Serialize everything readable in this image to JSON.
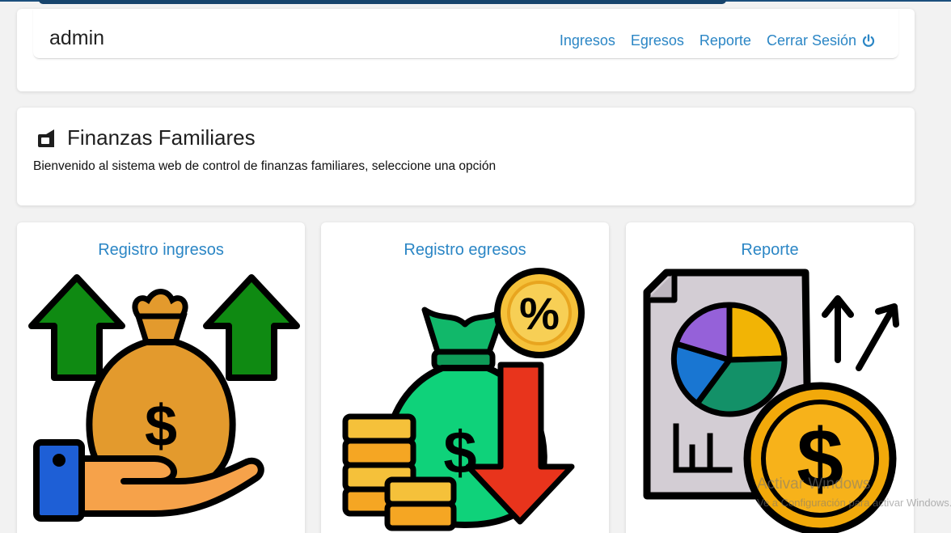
{
  "navbar": {
    "brand": "admin",
    "links": [
      {
        "label": "Ingresos"
      },
      {
        "label": "Egresos"
      },
      {
        "label": "Reporte"
      },
      {
        "label": "Cerrar Sesión"
      }
    ]
  },
  "hero": {
    "title": "Finanzas Familiares",
    "subtitle": "Bienvenido al sistema web de control de finanzas familiares, seleccione una opción"
  },
  "options": [
    {
      "title": "Registro ingresos",
      "icon": "money-bag-hand-arrows-up-icon"
    },
    {
      "title": "Registro egresos",
      "icon": "money-bag-percent-arrow-down-icon"
    },
    {
      "title": "Reporte",
      "icon": "report-pie-chart-coin-icon"
    }
  ],
  "watermark": {
    "title": "Activar Windows",
    "subtitle": "Ve a Configuración para activar Windows."
  },
  "colors": {
    "link": "#2b86c5",
    "topbar": "#17446c",
    "arrow_green": "#0f8a12",
    "arrow_red": "#e8341c",
    "gold": "#f5a623"
  }
}
